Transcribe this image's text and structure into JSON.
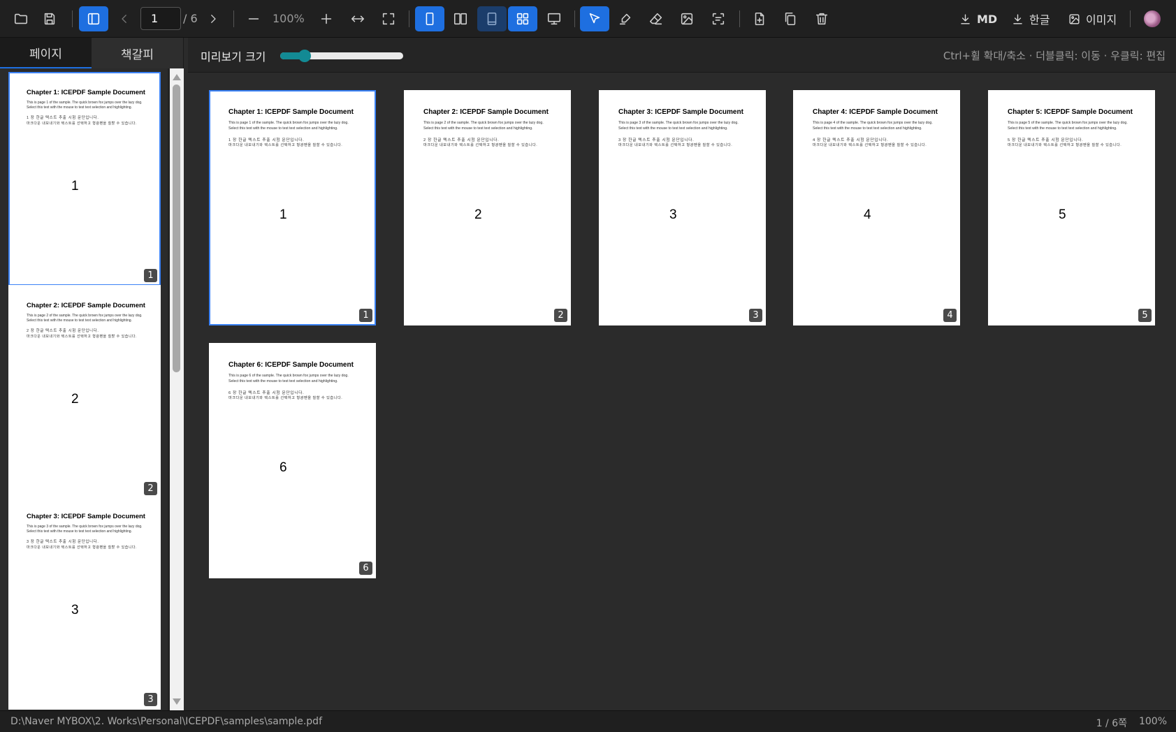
{
  "toolbar": {
    "page_current": "1",
    "page_total": "/ 6",
    "zoom": "100%",
    "icons": [
      "folder-open-icon",
      "save-icon",
      "sidebar-toggle-icon",
      "chevron-left-icon",
      "chevron-right-icon",
      "zoom-out-icon",
      "zoom-in-icon",
      "fit-width-icon",
      "fit-page-icon",
      "single-page-icon",
      "two-page-icon",
      "book-icon",
      "grid-icon",
      "presentation-icon",
      "select-cursor-icon",
      "highlighter-icon",
      "eraser-icon",
      "image-icon",
      "ocr-scan-icon",
      "add-page-icon",
      "duplicate-page-icon",
      "delete-page-icon"
    ],
    "export": {
      "md": "MD",
      "hangul": "한글",
      "image": "이미지"
    }
  },
  "sidebar": {
    "tabs": [
      {
        "label": "페이지"
      },
      {
        "label": "책갈피"
      }
    ]
  },
  "preview": {
    "label": "미리보기 크기",
    "slider_fraction": 0.2,
    "hint": "Ctrl+휠 확대/축소 · 더블클릭: 이동 · 우클릭: 편집"
  },
  "pages": [
    {
      "num": "1",
      "title": "Chapter 1: ICEPDF Sample Document",
      "line1": "This is page 1 of the sample. The quick brown fox jumps over the lazy dog.",
      "line2": "Select this text with the mouse to test text selection and highlighting.",
      "line3": "1 장  한글  텍스트  추출  시험  문단입니다.",
      "line4": "마크다운  내보내기와  텍스트를  선택하고  형광펜을  칠할  수  있습니다."
    },
    {
      "num": "2",
      "title": "Chapter 2: ICEPDF Sample Document",
      "line1": "This is page 2 of the sample. The quick brown fox jumps over the lazy dog.",
      "line2": "Select this text with the mouse to test text selection and highlighting.",
      "line3": "2 장  한글  텍스트  추출  시험  문단입니다.",
      "line4": "마크다운  내보내기와  텍스트를  선택하고  형광펜을  칠할  수  있습니다."
    },
    {
      "num": "3",
      "title": "Chapter 3: ICEPDF Sample Document",
      "line1": "This is page 3 of the sample. The quick brown fox jumps over the lazy dog.",
      "line2": "Select this text with the mouse to test text selection and highlighting.",
      "line3": "3 장  한글  텍스트  추출  시험  문단입니다.",
      "line4": "마크다운  내보내기와  텍스트를  선택하고  형광펜을  칠할  수  있습니다."
    },
    {
      "num": "4",
      "title": "Chapter 4: ICEPDF Sample Document",
      "line1": "This is page 4 of the sample. The quick brown fox jumps over the lazy dog.",
      "line2": "Select this text with the mouse to test text selection and highlighting.",
      "line3": "4 장  한글  텍스트  추출  시험  문단입니다.",
      "line4": "마크다운  내보내기와  텍스트를  선택하고  형광펜을  칠할  수  있습니다."
    },
    {
      "num": "5",
      "title": "Chapter 5: ICEPDF Sample Document",
      "line1": "This is page 5 of the sample. The quick brown fox jumps over the lazy dog.",
      "line2": "Select this text with the mouse to test text selection and highlighting.",
      "line3": "5 장  한글  텍스트  추출  시험  문단입니다.",
      "line4": "마크다운  내보내기와  텍스트를  선택하고  형광펜을  칠할  수  있습니다."
    },
    {
      "num": "6",
      "title": "Chapter 6: ICEPDF Sample Document",
      "line1": "This is page 6 of the sample. The quick brown fox jumps over the lazy dog.",
      "line2": "Select this text with the mouse to test text selection and highlighting.",
      "line3": "6 장  한글  텍스트  추출  시험  문단입니다.",
      "line4": "마크다운  내보내기와  텍스트를  선택하고  형광펜을  칠할  수  있습니다."
    }
  ],
  "status": {
    "path": "D:\\Naver MYBOX\\2. Works\\Personal\\ICEPDF\\samples\\sample.pdf",
    "pages": "1 / 6쪽",
    "zoom": "100%"
  },
  "colors": {
    "accent": "#1e6fe0",
    "slider": "#138a94",
    "background": "#2b2b2b",
    "toolbar": "#202020"
  }
}
